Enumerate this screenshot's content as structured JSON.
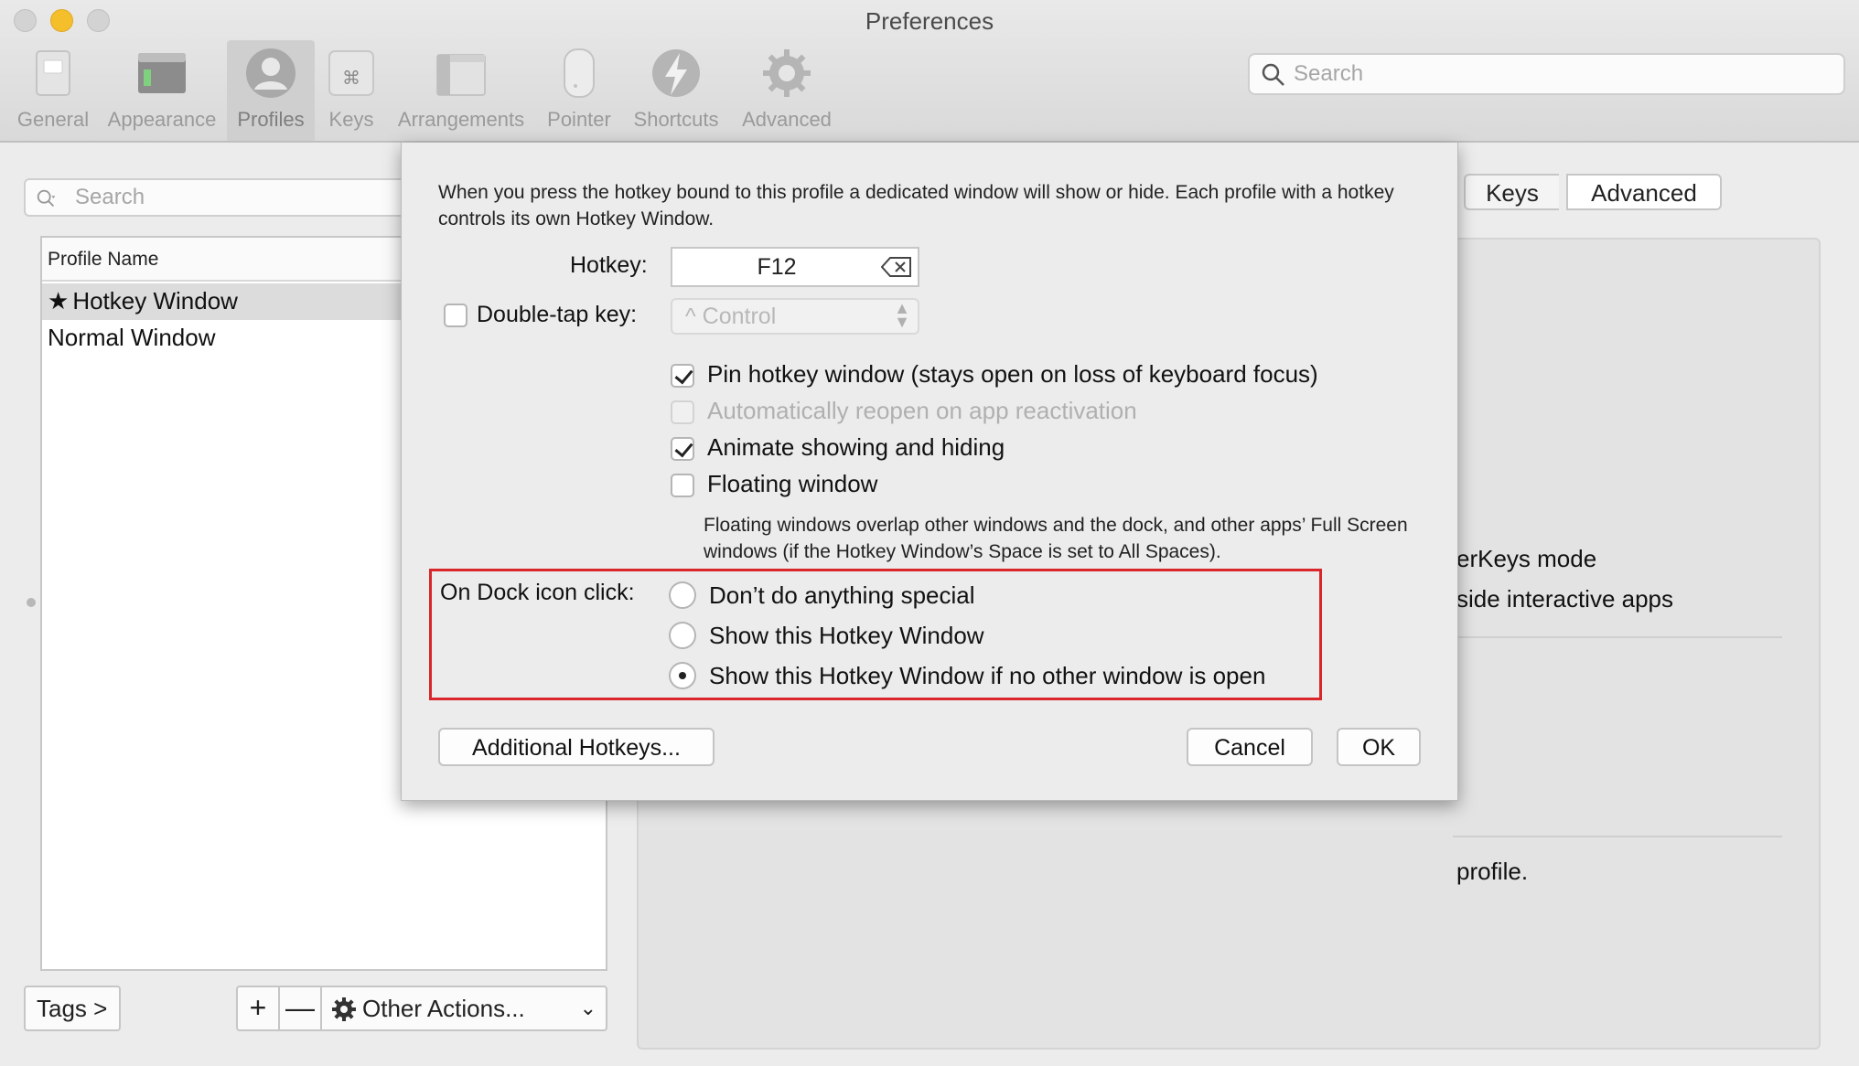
{
  "window": {
    "title": "Preferences"
  },
  "toolbar": {
    "items": [
      {
        "label": "General",
        "icon": "switch-icon"
      },
      {
        "label": "Appearance",
        "icon": "window-icon"
      },
      {
        "label": "Profiles",
        "icon": "user-icon",
        "selected": true
      },
      {
        "label": "Keys",
        "icon": "command-key-icon"
      },
      {
        "label": "Arrangements",
        "icon": "windows-stack-icon"
      },
      {
        "label": "Pointer",
        "icon": "mouse-icon"
      },
      {
        "label": "Shortcuts",
        "icon": "lightning-icon"
      },
      {
        "label": "Advanced",
        "icon": "gear-icon"
      }
    ],
    "search_placeholder": "Search"
  },
  "profiles": {
    "search_placeholder": "Search",
    "header": "Profile Name",
    "rows": [
      {
        "name": "Hotkey Window",
        "star": "★",
        "selected": true
      },
      {
        "name": "Normal Window"
      }
    ],
    "tags_label": "Tags >",
    "add_label": "+",
    "remove_label": "—",
    "other_actions_label": "Other Actions...",
    "other_actions_chevron": "⌄"
  },
  "right_pane": {
    "tabs": [
      "Keys",
      "Advanced"
    ],
    "visible_text": [
      "erKeys mode",
      "side interactive apps",
      "profile."
    ]
  },
  "sheet": {
    "description": "When you press the hotkey bound to this profile a dedicated window will show or hide. Each profile with a hotkey controls its own Hotkey Window.",
    "hotkey_label": "Hotkey:",
    "hotkey_value": "F12",
    "double_tap_label": "Double-tap key:",
    "double_tap_checked": false,
    "double_tap_value": "^ Control",
    "options": [
      {
        "label": "Pin hotkey window (stays open on loss of keyboard focus)",
        "checked": true,
        "enabled": true
      },
      {
        "label": "Automatically reopen on app reactivation",
        "checked": false,
        "enabled": false
      },
      {
        "label": "Animate showing and hiding",
        "checked": true,
        "enabled": true
      },
      {
        "label": "Floating window",
        "checked": false,
        "enabled": true
      }
    ],
    "floating_note": "Floating windows overlap other windows and the dock, and other apps’ Full Screen windows (if the Hotkey Window’s Space is set to All Spaces).",
    "dock_label": "On Dock icon click:",
    "dock_options": [
      {
        "label": "Don’t do anything special",
        "selected": false
      },
      {
        "label": "Show this Hotkey Window",
        "selected": false
      },
      {
        "label": "Show this Hotkey Window if no other window is open",
        "selected": true
      }
    ],
    "highlight_color": "#d9262b",
    "buttons": {
      "additional": "Additional Hotkeys...",
      "cancel": "Cancel",
      "ok": "OK"
    }
  }
}
